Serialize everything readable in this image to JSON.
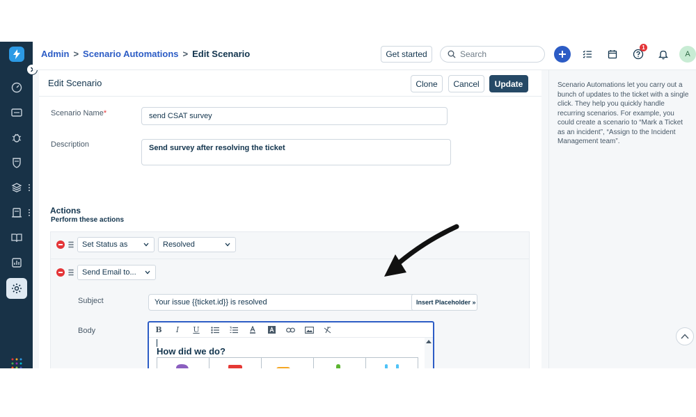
{
  "breadcrumb": {
    "admin": "Admin",
    "sep1": ">",
    "automations": "Scenario Automations",
    "sep2": ">",
    "current": "Edit Scenario"
  },
  "header": {
    "get_started": "Get started",
    "search_placeholder": "Search",
    "help_badge_count": "1",
    "avatar_initial": "A"
  },
  "subheader": {
    "title": "Edit Scenario",
    "clone": "Clone",
    "cancel": "Cancel",
    "update": "Update"
  },
  "form": {
    "scenario_name_label": "Scenario Name",
    "required_mark": "*",
    "scenario_name_value": "send CSAT survey",
    "description_label": "Description",
    "description_value": "Send survey after resolving the ticket"
  },
  "actions": {
    "title": "Actions",
    "subtitle": "Perform these actions",
    "rows": [
      {
        "action": "Set Status as",
        "value": "Resolved"
      },
      {
        "action": "Send Email to..."
      }
    ],
    "subject_label": "Subject",
    "subject_value": "Your issue {{ticket.id}} is resolved",
    "insert_placeholder": "Insert Placeholder »",
    "body_label": "Body",
    "editor_heading": "How did we do?",
    "emoji_cells": [
      "purple-unhappy-icon",
      "red-thumbs-down-icon",
      "orange-thumbs-sideways-icon",
      "green-thumbs-up-icon",
      "blue-rock-hand-icon"
    ]
  },
  "toolbar": [
    "bold-icon",
    "italic-icon",
    "underline-icon",
    "bullet-list-icon",
    "numbered-list-icon",
    "font-color-icon",
    "background-color-icon",
    "link-icon",
    "image-icon",
    "clear-format-icon"
  ],
  "right_panel": {
    "help_text": "Scenario Automations let you carry out a bunch of updates to the ticket with a single click. They help you quickly handle recurring scenarios. For example, you could create a scenario to “Mark a Ticket as an incident”, “Assign to the Incident Management team”."
  },
  "colors": {
    "sidebar": "#183247",
    "accent": "#2c5cc5",
    "update_button": "#264966",
    "danger": "#e43538"
  }
}
